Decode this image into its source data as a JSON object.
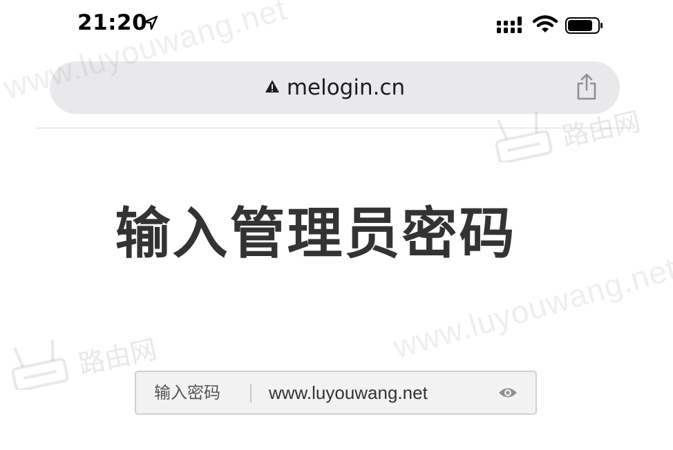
{
  "status_bar": {
    "time": "21:20",
    "icons": [
      "location-arrow-icon",
      "signal-icon",
      "wifi-icon",
      "battery-icon"
    ]
  },
  "browser": {
    "url": "melogin.cn",
    "security_icon": "warning-triangle-icon",
    "share_icon": "share-icon"
  },
  "page": {
    "title": "输入管理员密码",
    "password": {
      "label": "输入密码",
      "value": "www.luyouwang.net",
      "visibility_icon": "eye-icon"
    }
  },
  "watermark": {
    "text": "www.luyouwang.net",
    "logo_text": "路由网"
  }
}
